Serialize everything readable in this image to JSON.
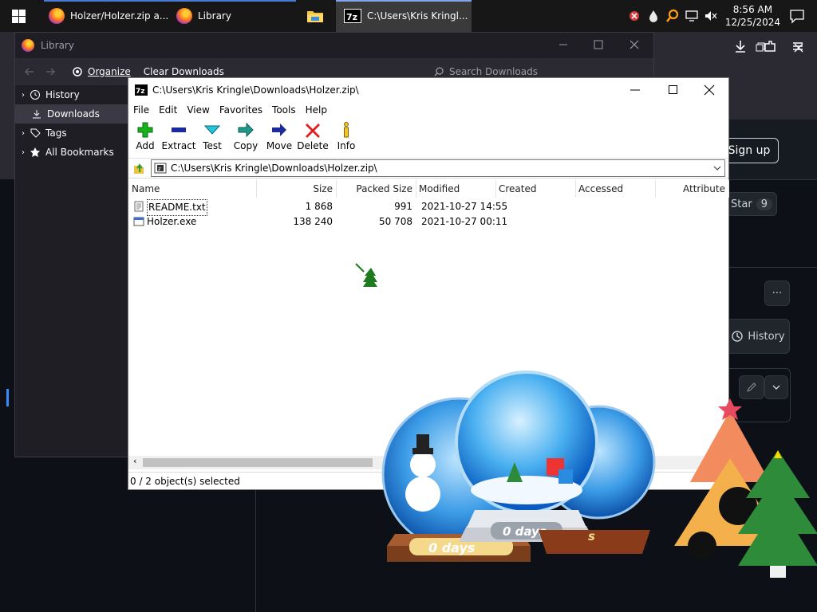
{
  "taskbar": {
    "items": [
      {
        "label": "Holzer/Holzer.zip a..."
      },
      {
        "label": "Library"
      },
      {
        "label": "C:\\Users\\Kris Kringl..."
      }
    ],
    "clock": {
      "time": "8:56 AM",
      "date": "12/25/2024"
    }
  },
  "github": {
    "sign_up": "Sign up",
    "star_label": "Star",
    "star_count": "9",
    "more_label": "···",
    "history_label": "History"
  },
  "library": {
    "title": "Library",
    "organize_label": "Organize",
    "clear_label": "Clear Downloads",
    "search_placeholder": "Search Downloads",
    "sidebar": [
      {
        "label": "History"
      },
      {
        "label": "Downloads"
      },
      {
        "label": "Tags"
      },
      {
        "label": "All Bookmarks"
      }
    ]
  },
  "zip": {
    "title": "C:\\Users\\Kris Kringle\\Downloads\\Holzer.zip\\",
    "menu": [
      "File",
      "Edit",
      "View",
      "Favorites",
      "Tools",
      "Help"
    ],
    "toolbar": [
      {
        "label": "Add",
        "icon": "plus-icon"
      },
      {
        "label": "Extract",
        "icon": "extract-icon"
      },
      {
        "label": "Test",
        "icon": "test-icon"
      },
      {
        "label": "Copy",
        "icon": "copy-icon"
      },
      {
        "label": "Move",
        "icon": "move-icon"
      },
      {
        "label": "Delete",
        "icon": "delete-icon"
      },
      {
        "label": "Info",
        "icon": "info-icon"
      }
    ],
    "address": "C:\\Users\\Kris Kringle\\Downloads\\Holzer.zip\\",
    "columns": [
      "Name",
      "Size",
      "Packed Size",
      "Modified",
      "Created",
      "Accessed",
      "Attribute"
    ],
    "files": [
      {
        "name": "README.txt",
        "size": "1 868",
        "packed": "991",
        "modified": "2021-10-27 14:55"
      },
      {
        "name": "Holzer.exe",
        "size": "138 240",
        "packed": "50 708",
        "modified": "2021-10-27 00:11"
      }
    ],
    "status": "0 / 2 object(s) selected"
  },
  "decor": {
    "globe_label_1": "0 days",
    "globe_label_2": "0 days",
    "globe_label_3": "s"
  }
}
